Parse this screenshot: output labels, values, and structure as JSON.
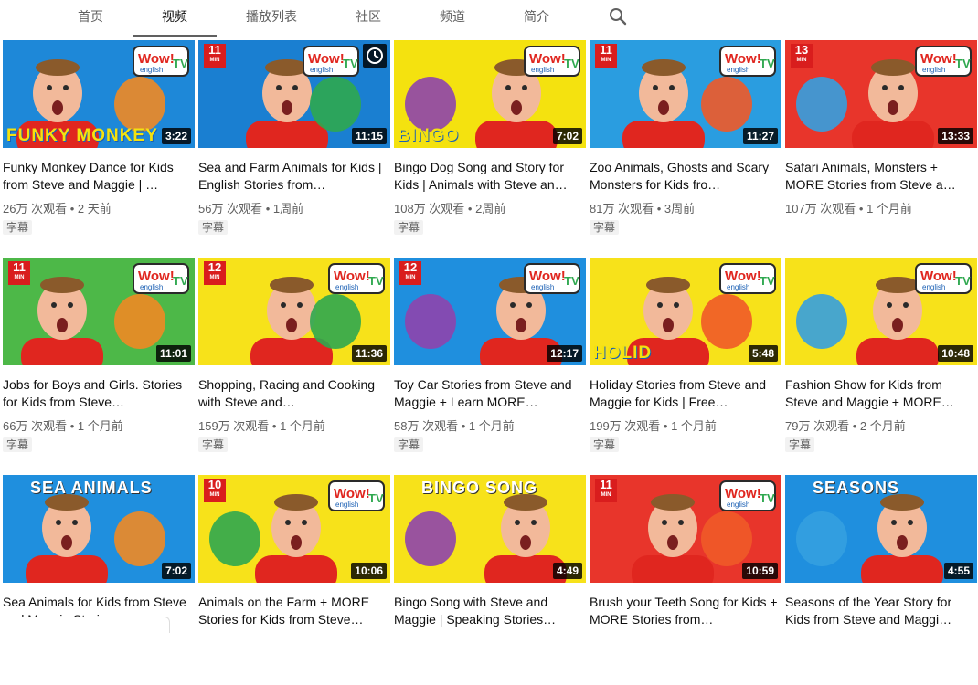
{
  "tabs": [
    {
      "label": "首页"
    },
    {
      "label": "视频"
    },
    {
      "label": "播放列表"
    },
    {
      "label": "社区"
    },
    {
      "label": "频道"
    },
    {
      "label": "简介"
    }
  ],
  "active_tab": "视频",
  "search_icon": "search-icon",
  "videos": [
    {
      "title": "Funky Monkey Dance for Kids from Steve and Maggie | …",
      "views": "26万 次观看",
      "age": "2 天前",
      "duration": "3:22",
      "badge": "字幕",
      "caption": "FUNKY MONKEY",
      "min": "",
      "bg": "#1e88d8"
    },
    {
      "title": "Sea and Farm Animals for Kids | English Stories from…",
      "views": "56万 次观看",
      "age": "1周前",
      "duration": "11:15",
      "badge": "字幕",
      "caption": "",
      "min": "11",
      "bg": "#1a7fd1"
    },
    {
      "title": "Bingo Dog Song and Story for Kids | Animals with Steve an…",
      "views": "108万 次观看",
      "age": "2周前",
      "duration": "7:02",
      "badge": "字幕",
      "caption": "BINGO",
      "min": "",
      "bg": "#f4e20f"
    },
    {
      "title": "Zoo Animals, Ghosts and Scary Monsters for Kids fro…",
      "views": "81万 次观看",
      "age": "3周前",
      "duration": "11:27",
      "badge": "字幕",
      "caption": "",
      "min": "11",
      "bg": "#2a9de0"
    },
    {
      "title": "Safari Animals, Monsters + MORE Stories from Steve a…",
      "views": "107万 次观看",
      "age": "1 个月前",
      "duration": "13:33",
      "badge": "",
      "caption": "",
      "min": "13",
      "bg": "#e8352b"
    },
    {
      "title": "Jobs for Boys and Girls. Stories for Kids from Steve…",
      "views": "66万 次观看",
      "age": "1 个月前",
      "duration": "11:01",
      "badge": "字幕",
      "caption": "",
      "min": "11",
      "bg": "#4db848"
    },
    {
      "title": "Shopping, Racing and Cooking with Steve and…",
      "views": "159万 次观看",
      "age": "1 个月前",
      "duration": "11:36",
      "badge": "字幕",
      "caption": "",
      "min": "12",
      "bg": "#f7e21a"
    },
    {
      "title": "Toy Car Stories from Steve and Maggie + Learn MORE…",
      "views": "58万 次观看",
      "age": "1 个月前",
      "duration": "12:17",
      "badge": "字幕",
      "caption": "",
      "min": "12",
      "bg": "#1f8fde"
    },
    {
      "title": "Holiday Stories from Steve and Maggie for Kids | Free…",
      "views": "199万 次观看",
      "age": "1 个月前",
      "duration": "5:48",
      "badge": "字幕",
      "caption": "HOLID",
      "min": "",
      "bg": "#f7e21a"
    },
    {
      "title": "Fashion Show for Kids from Steve and Maggie + MORE…",
      "views": "79万 次观看",
      "age": "2 个月前",
      "duration": "10:48",
      "badge": "字幕",
      "caption": "",
      "min": "",
      "bg": "#f7e21a"
    },
    {
      "title": "Sea Animals for Kids from Steve and Maggie Stories…",
      "views": "",
      "age": "",
      "duration": "7:02",
      "badge": "",
      "caption": "SEA ANIMALS",
      "min": "",
      "bg": "#1f8fde"
    },
    {
      "title": "Animals on the Farm + MORE Stories for Kids from Steve…",
      "views": "",
      "age": "",
      "duration": "10:06",
      "badge": "",
      "caption": "",
      "min": "10",
      "bg": "#f7e21a"
    },
    {
      "title": "Bingo Song with Steve and Maggie | Speaking Stories…",
      "views": "",
      "age": "",
      "duration": "4:49",
      "badge": "",
      "caption": "BINGO SONG",
      "min": "",
      "bg": "#f7e21a"
    },
    {
      "title": "Brush your Teeth Song for Kids + MORE Stories from…",
      "views": "",
      "age": "",
      "duration": "10:59",
      "badge": "",
      "caption": "",
      "min": "11",
      "bg": "#e8352b"
    },
    {
      "title": "Seasons of the Year Story for Kids from Steve and Maggi…",
      "views": "",
      "age": "",
      "duration": "4:55",
      "badge": "",
      "caption": "SEASONS",
      "min": "",
      "bg": "#1f8fde"
    }
  ],
  "logo_text": "Wow!",
  "logo_sub": "english",
  "logo_tv": "TV",
  "min_label": "MIN",
  "meta_sep": " • "
}
